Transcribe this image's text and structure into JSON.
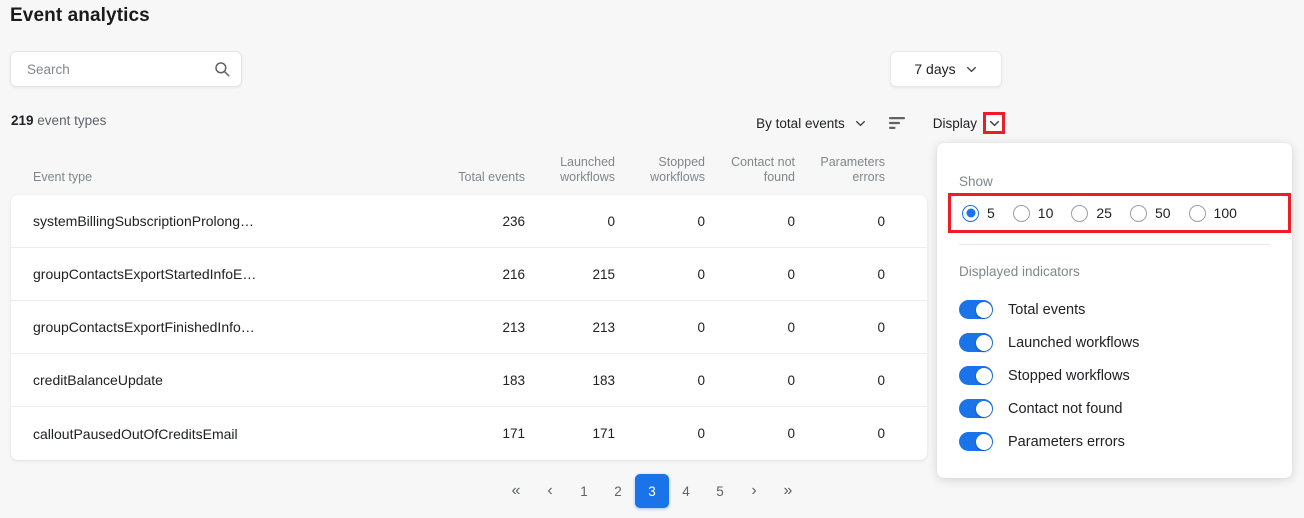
{
  "header": {
    "title": "Event analytics"
  },
  "search": {
    "placeholder": "Search",
    "value": "",
    "icon": "search-icon"
  },
  "date_range": {
    "label": "7 days",
    "icon": "chevron-down-icon"
  },
  "summary": {
    "count": "219",
    "label": "event types"
  },
  "controls": {
    "sort_select_label": "By total events",
    "sort_select_icon": "chevron-down-icon",
    "sort_direction_icon": "sort-descending-icon",
    "display_label": "Display",
    "display_icon": "chevron-down-icon"
  },
  "table": {
    "columns": [
      {
        "label": "Event type",
        "line1": "Event type",
        "line2": ""
      },
      {
        "label": "Total events",
        "line1": "",
        "line2": "Total events"
      },
      {
        "label": "Launched workflows",
        "line1": "Launched",
        "line2": "workflows"
      },
      {
        "label": "Stopped workflows",
        "line1": "Stopped",
        "line2": "workflows"
      },
      {
        "label": "Contact not found",
        "line1": "Contact not",
        "line2": "found"
      },
      {
        "label": "Parameters errors",
        "line1": "Parameters",
        "line2": "errors"
      }
    ],
    "rows": [
      {
        "event_type": "systemBillingSubscriptionProlong…",
        "total_events": "236",
        "launched_workflows": "0",
        "stopped_workflows": "0",
        "contact_not_found": "0",
        "parameters_errors": "0"
      },
      {
        "event_type": "groupContactsExportStartedInfoE…",
        "total_events": "216",
        "launched_workflows": "215",
        "stopped_workflows": "0",
        "contact_not_found": "0",
        "parameters_errors": "0"
      },
      {
        "event_type": "groupContactsExportFinishedInfo…",
        "total_events": "213",
        "launched_workflows": "213",
        "stopped_workflows": "0",
        "contact_not_found": "0",
        "parameters_errors": "0"
      },
      {
        "event_type": "creditBalanceUpdate",
        "total_events": "183",
        "launched_workflows": "183",
        "stopped_workflows": "0",
        "contact_not_found": "0",
        "parameters_errors": "0"
      },
      {
        "event_type": "calloutPausedOutOfCreditsEmail",
        "total_events": "171",
        "launched_workflows": "171",
        "stopped_workflows": "0",
        "contact_not_found": "0",
        "parameters_errors": "0"
      }
    ]
  },
  "pagination": {
    "first_icon": "«",
    "prev_icon": "‹",
    "next_icon": "›",
    "last_icon": "»",
    "pages": [
      "1",
      "2",
      "3",
      "4",
      "5"
    ],
    "active_page": "3"
  },
  "display_panel": {
    "show_label": "Show",
    "show_options": [
      "5",
      "10",
      "25",
      "50",
      "100"
    ],
    "show_selected": "5",
    "indicators_label": "Displayed indicators",
    "indicators": [
      {
        "label": "Total events",
        "on": true
      },
      {
        "label": "Launched workflows",
        "on": true
      },
      {
        "label": "Stopped workflows",
        "on": true
      },
      {
        "label": "Contact not found",
        "on": true
      },
      {
        "label": "Parameters errors",
        "on": true
      }
    ]
  },
  "colors": {
    "accent": "#1a73e8",
    "highlight": "#ee1c25",
    "page_bg": "#f7f7f7",
    "card_bg": "#ffffff",
    "muted_text": "#80868b"
  }
}
